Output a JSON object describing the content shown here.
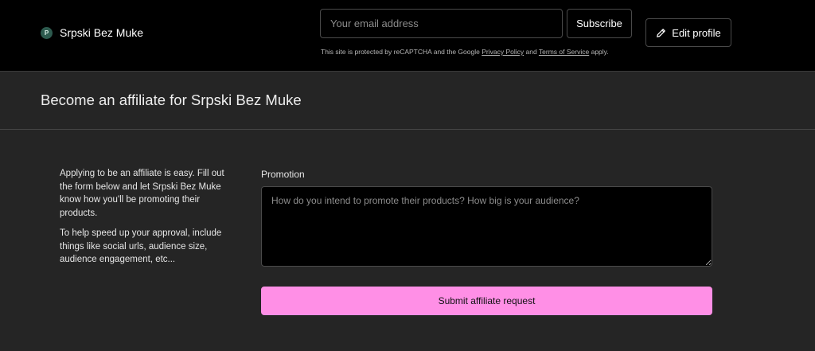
{
  "header": {
    "brand_initial": "P",
    "brand_name": "Srpski Bez Muke",
    "email_placeholder": "Your email address",
    "subscribe_label": "Subscribe",
    "recaptcha": {
      "prefix": "This site is protected by reCAPTCHA and the Google",
      "privacy_label": "Privacy Policy",
      "and": "and",
      "terms_label": "Terms of Service",
      "suffix": "apply."
    },
    "edit_profile_label": "Edit profile",
    "edit_icon": "pencil-icon"
  },
  "page": {
    "title": "Become an affiliate for Srpski Bez Muke"
  },
  "intro": {
    "paragraph_1": "Applying to be an affiliate is easy. Fill out the form below and let Srpski Bez Muke know how you'll be promoting their products.",
    "paragraph_2": "To help speed up your approval, include things like social urls, audience size, audience engagement, etc..."
  },
  "form": {
    "promotion_label": "Promotion",
    "promotion_value": "",
    "promotion_placeholder": "How do you intend to promote their products? How big is your audience?",
    "submit_label": "Submit affiliate request"
  },
  "colors": {
    "background": "#252525",
    "topbar": "#000000",
    "accent": "#ff8fe6",
    "avatar": "#2d5a4e"
  }
}
